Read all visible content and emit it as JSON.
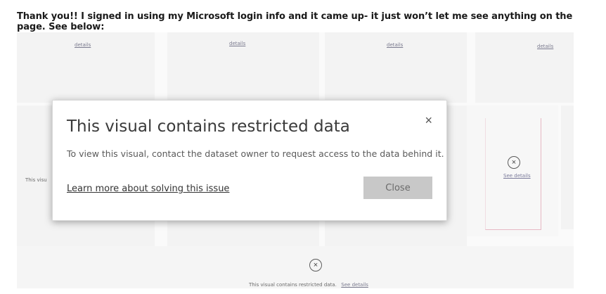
{
  "post": {
    "text": "Thank you!! I signed in using my Microsoft login info and it came up- it just won’t let me see anything on the page. See below:"
  },
  "tiles": {
    "see_details": "See details",
    "details": "details",
    "side_fragment": "This visu",
    "bottom_message": "This visual contains restricted data.",
    "bottom_link": "See details"
  },
  "dialog": {
    "title": "This visual contains restricted data",
    "close_glyph": "×",
    "message": "To view this visual, contact the dataset owner to request access to the data behind it.",
    "learn_more_link": "Learn more about solving this issue",
    "close_button": "Close"
  },
  "icons": {
    "restricted": "×"
  }
}
